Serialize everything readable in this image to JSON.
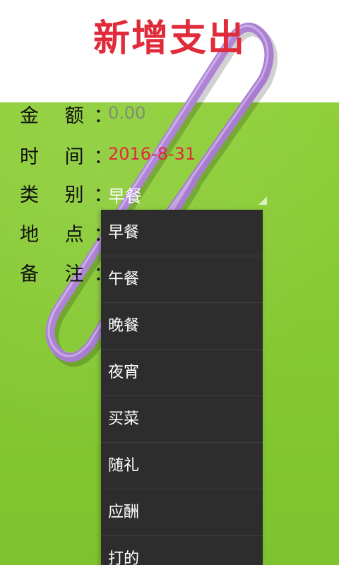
{
  "title": "新增支出",
  "form": {
    "amount_label": "金 额：",
    "amount_value": "0.00",
    "time_label": "时 间：",
    "time_value": "2016-8-31",
    "category_label": "类 别：",
    "category_value": "早餐",
    "location_label": "地 点：",
    "note_label": "备 注："
  },
  "dropdown": {
    "options": [
      "早餐",
      "午餐",
      "晚餐",
      "夜宵",
      "买菜",
      "随礼",
      "应酬",
      "打的"
    ]
  },
  "colors": {
    "title": "#e02b3a",
    "date": "#e02b3a",
    "amount": "#7f8f72",
    "background_green": "#86c933",
    "dropdown_bg": "#2d2d2d",
    "paperclip": "#b58ad8"
  }
}
